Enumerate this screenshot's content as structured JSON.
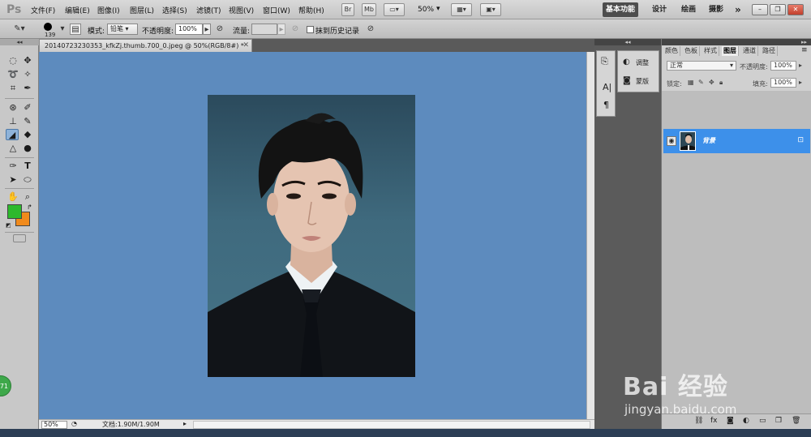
{
  "app": {
    "logo": "Ps",
    "menu": [
      "文件(F)",
      "编辑(E)",
      "图像(I)",
      "图层(L)",
      "选择(S)",
      "滤镜(T)",
      "视图(V)",
      "窗口(W)",
      "帮助(H)"
    ],
    "toolbar_buttons": [
      "Br",
      "Mb"
    ],
    "zoom_display": "50%",
    "workspaces": [
      "基本功能",
      "设计",
      "绘画",
      "摄影"
    ],
    "workspace_more": "»"
  },
  "options": {
    "brush_size": "139",
    "mode_label": "模式:",
    "mode_value": "铅笔",
    "opacity_label": "不透明度:",
    "opacity_value": "100%",
    "flow_label": "流量:",
    "flow_value": "",
    "history_checkbox_label": "抹到历史记录"
  },
  "document": {
    "tab_title": "20140723230353_kfkZj.thumb.700_0.jpeg @ 50%(RGB/8#) *",
    "status_zoom": "50%",
    "status_doc": "文档:1.90M/1.90M"
  },
  "dock": {
    "adjust_label": "调整",
    "mask_label": "蒙版"
  },
  "layers": {
    "tabs": [
      "颜色",
      "色板",
      "样式",
      "图层",
      "通道",
      "路径"
    ],
    "active_tab": "图层",
    "blend_mode": "正常",
    "opacity_label": "不透明度:",
    "opacity_value": "100%",
    "lock_label": "锁定:",
    "fill_label": "填充:",
    "fill_value": "100%",
    "layer_name": "背景"
  },
  "colors": {
    "foreground": "#2db92d",
    "background": "#f08a1c",
    "canvas_bg": "#5d8bbe",
    "layer_selected": "#3d90ea"
  },
  "watermark": {
    "logo_text": "Bai 经验",
    "url_text": "jingyan.baidu.com",
    "badge_text": "71"
  }
}
